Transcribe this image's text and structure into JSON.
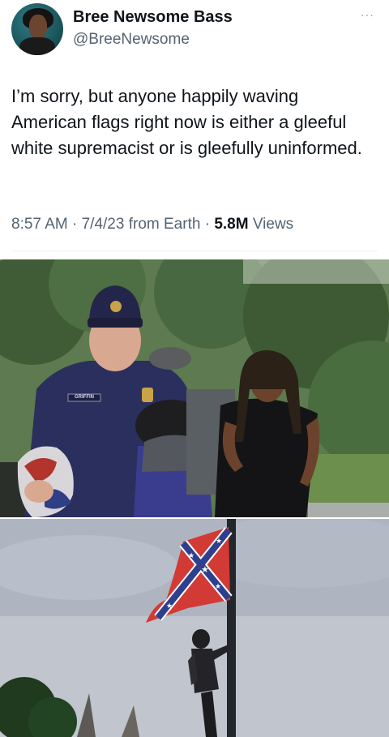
{
  "author": {
    "name": "Bree Newsome Bass",
    "handle": "@BreeNewsome",
    "avatar_icon": "profile-avatar"
  },
  "tweet": {
    "text": "I’m sorry, but anyone happily waving American flags right now is either a gleeful white supremacist or is gleefully uninformed.",
    "time": "8:57 AM",
    "date": "7/4/23",
    "source": "from Earth",
    "views_count": "5.8M",
    "views_label": "Views"
  },
  "more_icon": "···",
  "photos": [
    {
      "name_tag": "GRIFFIN"
    },
    {}
  ],
  "colors": {
    "text": "#0f1419",
    "muted": "#536471"
  }
}
